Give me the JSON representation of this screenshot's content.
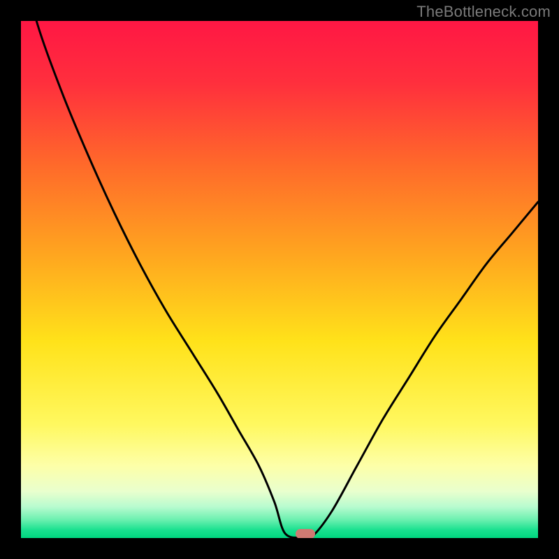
{
  "watermark": "TheBottleneck.com",
  "chart_data": {
    "type": "line",
    "title": "",
    "xlabel": "",
    "ylabel": "",
    "xlim": [
      0,
      100
    ],
    "ylim": [
      0,
      100
    ],
    "grid": false,
    "legend": false,
    "series": [
      {
        "name": "bottleneck-curve",
        "x": [
          0,
          3,
          8,
          13,
          18,
          23,
          28,
          33,
          38,
          42,
          46,
          49,
          51,
          54,
          56,
          60,
          65,
          70,
          75,
          80,
          85,
          90,
          95,
          100
        ],
        "y": [
          113,
          100,
          86,
          74,
          63,
          53,
          44,
          36,
          28,
          21,
          14,
          7,
          1,
          0,
          0,
          5,
          14,
          23,
          31,
          39,
          46,
          53,
          59,
          65
        ]
      }
    ],
    "annotations": [
      {
        "name": "optimal-marker",
        "x": 55,
        "y": 0.8,
        "color": "#cf7a72"
      }
    ],
    "background_gradient": {
      "stops": [
        {
          "offset": 0.0,
          "color": "#ff1744"
        },
        {
          "offset": 0.12,
          "color": "#ff2f3d"
        },
        {
          "offset": 0.28,
          "color": "#ff6a2a"
        },
        {
          "offset": 0.45,
          "color": "#ffa51f"
        },
        {
          "offset": 0.62,
          "color": "#ffe21a"
        },
        {
          "offset": 0.78,
          "color": "#fff85f"
        },
        {
          "offset": 0.86,
          "color": "#fdffa8"
        },
        {
          "offset": 0.91,
          "color": "#e9ffce"
        },
        {
          "offset": 0.94,
          "color": "#b7fbcf"
        },
        {
          "offset": 0.965,
          "color": "#6af0af"
        },
        {
          "offset": 0.985,
          "color": "#17e08e"
        },
        {
          "offset": 1.0,
          "color": "#00d67f"
        }
      ]
    }
  }
}
